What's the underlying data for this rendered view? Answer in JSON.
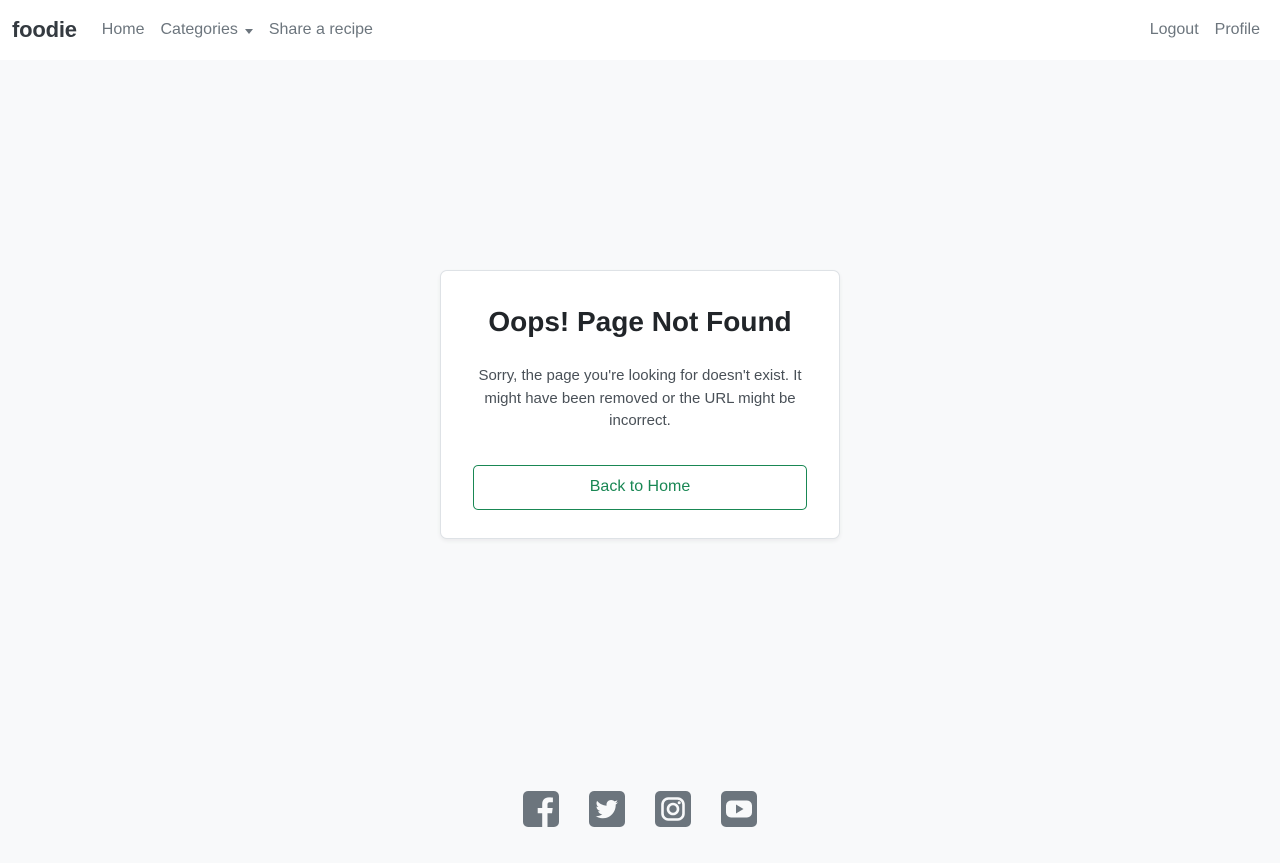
{
  "navbar": {
    "brand": "foodie",
    "links": [
      {
        "label": "Home"
      },
      {
        "label": "Categories"
      },
      {
        "label": "Share a recipe"
      }
    ],
    "right_links": [
      {
        "label": "Logout"
      },
      {
        "label": "Profile"
      }
    ]
  },
  "error_card": {
    "title": "Oops! Page Not Found",
    "message": "Sorry, the page you're looking for doesn't exist. It might have been removed or the URL might be incorrect.",
    "button_label": "Back to Home"
  },
  "footer": {
    "social_icons": [
      "facebook-icon",
      "twitter-icon",
      "instagram-icon",
      "youtube-icon"
    ]
  },
  "colors": {
    "accent": "#198754",
    "background": "#f8f9fa",
    "icon": "#6c757d"
  }
}
